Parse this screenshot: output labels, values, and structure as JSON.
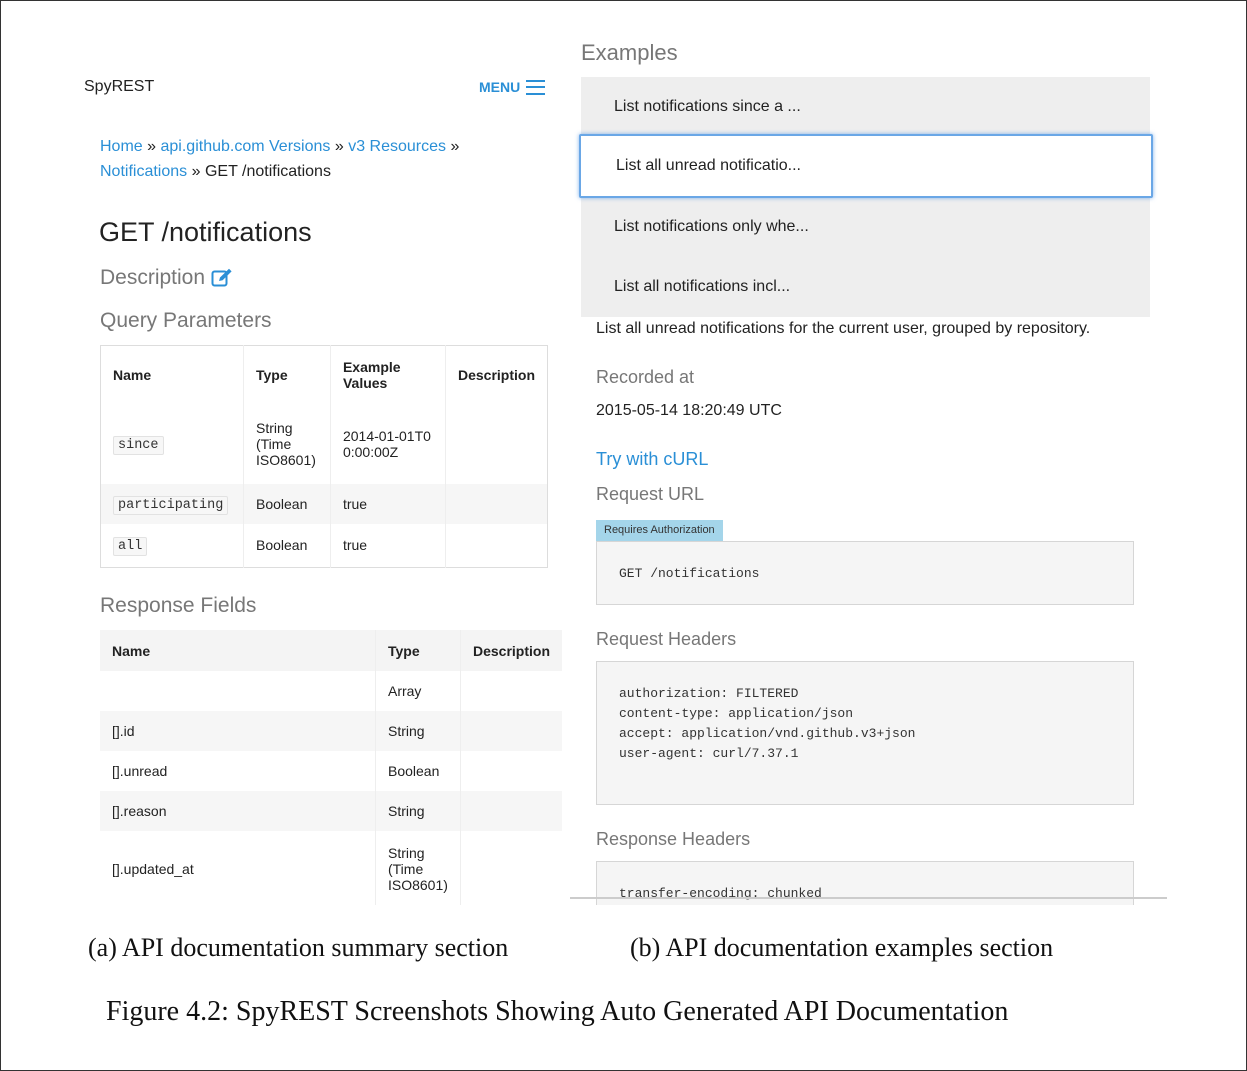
{
  "left": {
    "brand": "SpyREST",
    "menu_label": "MENU",
    "breadcrumb": {
      "links": [
        "Home",
        "api.github.com Versions",
        "v3 Resources",
        "Notifications"
      ],
      "current": "GET /notifications",
      "separator": "»"
    },
    "page_title": "GET /notifications",
    "description_heading": "Description",
    "query_params_heading": "Query Parameters",
    "query_params": {
      "headers": [
        "Name",
        "Type",
        "Example Values",
        "Description"
      ],
      "rows": [
        {
          "name": "since",
          "type": "String (Time ISO8601)",
          "example": "2014-01-01T00:00:00Z",
          "description": ""
        },
        {
          "name": "participating",
          "type": "Boolean",
          "example": "true",
          "description": ""
        },
        {
          "name": "all",
          "type": "Boolean",
          "example": "true",
          "description": ""
        }
      ]
    },
    "response_fields_heading": "Response Fields",
    "response_fields": {
      "headers": [
        "Name",
        "Type",
        "Description"
      ],
      "rows": [
        {
          "name": "",
          "type": "Array",
          "description": ""
        },
        {
          "name": "[].id",
          "type": "String",
          "description": ""
        },
        {
          "name": "[].unread",
          "type": "Boolean",
          "description": ""
        },
        {
          "name": "[].reason",
          "type": "String",
          "description": ""
        },
        {
          "name": "[].updated_at",
          "type": "String (Time ISO8601)",
          "description": ""
        }
      ]
    }
  },
  "right": {
    "examples_heading": "Examples",
    "examples": [
      {
        "label": "List notifications since a ...",
        "active": false
      },
      {
        "label": "List all unread notificatio...",
        "active": true
      },
      {
        "label": "List notifications only whe...",
        "active": false
      },
      {
        "label": "List all notifications incl...",
        "active": false
      }
    ],
    "example_description": "List all unread notifications for the current user, grouped by repository.",
    "recorded_at_heading": "Recorded at",
    "recorded_at_value": "2015-05-14 18:20:49 UTC",
    "try_curl_link": "Try with cURL",
    "request_url_heading": "Request URL",
    "auth_badge": "Requires Authorization",
    "request_url": "GET /notifications",
    "request_headers_heading": "Request Headers",
    "request_headers": [
      "authorization: FILTERED",
      "content-type: application/json",
      "accept: application/vnd.github.v3+json",
      "user-agent: curl/7.37.1"
    ],
    "response_headers_heading": "Response Headers",
    "response_headers": [
      "transfer-encoding: chunked"
    ]
  },
  "captions": {
    "a": "(a) API documentation summary section",
    "b": "(b) API documentation examples section",
    "figure": "Figure 4.2: SpyREST Screenshots Showing Auto Generated API Documentation"
  },
  "colors": {
    "link": "#2a8fd6",
    "badge": "#a4d5ea",
    "active_border": "#6aa7e6"
  }
}
